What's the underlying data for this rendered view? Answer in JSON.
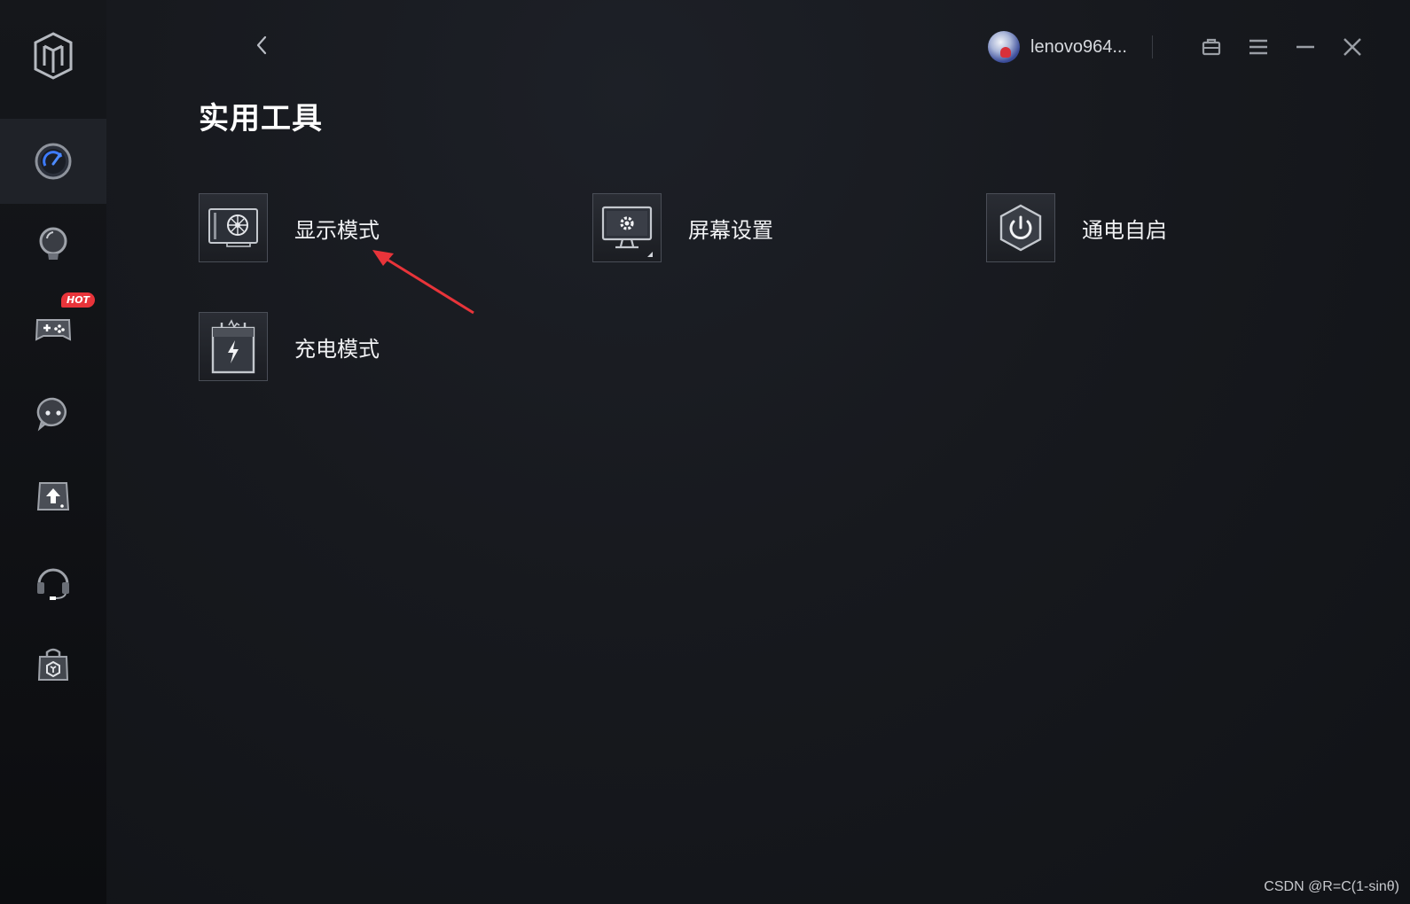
{
  "app": {
    "page_title": "实用工具",
    "user": {
      "name": "lenovo964...",
      "avatar_icon": "avatar"
    }
  },
  "sidebar": {
    "items": [
      {
        "name": "performance",
        "icon": "speedometer-icon",
        "active": true
      },
      {
        "name": "lighting",
        "icon": "lightbulb-icon",
        "active": false
      },
      {
        "name": "games",
        "icon": "gamepad-icon",
        "active": false,
        "badge": "HOT"
      },
      {
        "name": "assistant",
        "icon": "chat-bubble-icon",
        "active": false
      },
      {
        "name": "upload",
        "icon": "upload-box-icon",
        "active": false
      },
      {
        "name": "headset",
        "icon": "headset-icon",
        "active": false
      },
      {
        "name": "store",
        "icon": "shopping-bag-icon",
        "active": false
      }
    ]
  },
  "tools": [
    {
      "label": "显示模式",
      "icon": "display-card-icon"
    },
    {
      "label": "屏幕设置",
      "icon": "monitor-settings-icon"
    },
    {
      "label": "通电自启",
      "icon": "power-icon"
    },
    {
      "label": "充电模式",
      "icon": "battery-charge-icon"
    }
  ],
  "watermark": "CSDN @R=C(1-sinθ)",
  "colors": {
    "background": "#17191f",
    "sidebar": "#0c0d10",
    "active_nav": "#1f2228",
    "accent_blue": "#3d7bff",
    "hot_badge": "#e8343a",
    "annotation_arrow": "#e8343a"
  }
}
